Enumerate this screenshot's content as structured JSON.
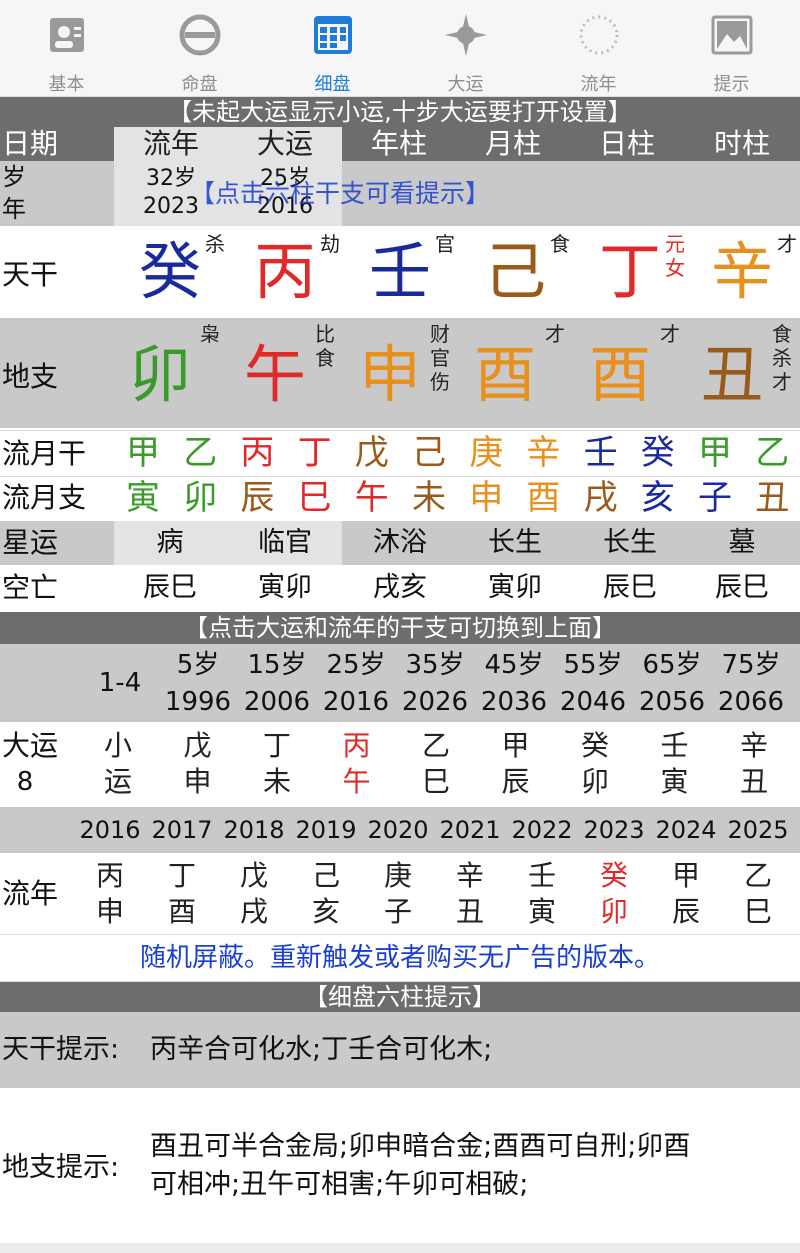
{
  "tabs": [
    {
      "label": "基本",
      "icon": "person-card-icon",
      "active": false
    },
    {
      "label": "命盘",
      "icon": "circle-minus-icon",
      "active": false
    },
    {
      "label": "细盘",
      "icon": "calendar-grid-icon",
      "active": true
    },
    {
      "label": "大运",
      "icon": "compass-icon",
      "active": false
    },
    {
      "label": "流年",
      "icon": "dotted-ring-icon",
      "active": false
    },
    {
      "label": "提示",
      "icon": "picture-icon",
      "active": false
    }
  ],
  "banner_top": "【未起大运显示小运,十步大运要打开设置】",
  "header": {
    "date": "日期",
    "liunian": "流年",
    "dayun": "大运",
    "nianzhu": "年柱",
    "yuezhu": "月柱",
    "rizhu": "日柱",
    "shizhu": "时柱"
  },
  "age_row": {
    "label_top": "岁",
    "label_bottom": "年",
    "ln_age": "32岁",
    "ln_year": "2023",
    "dy_age": "25岁",
    "dy_year": "2016",
    "hint": "【点击六柱干支可看提示】"
  },
  "tiangan": {
    "label": "天干",
    "cells": [
      {
        "char": "癸",
        "sup": "杀",
        "color": "#1a2a9e"
      },
      {
        "char": "丙",
        "sup": "劫",
        "color": "#e02a2a"
      },
      {
        "char": "壬",
        "sup": "官",
        "color": "#1a2a9e"
      },
      {
        "char": "己",
        "sup": "食",
        "color": "#9a5a1a"
      },
      {
        "char": "丁",
        "sup": "元\n女",
        "color": "#e02a2a",
        "sup_color": "#e02a2a"
      },
      {
        "char": "辛",
        "sup": "才",
        "color": "#e8901e"
      }
    ]
  },
  "dizhi": {
    "label": "地支",
    "cells": [
      {
        "char": "卯",
        "sup": "枭",
        "color": "#3a9a2a"
      },
      {
        "char": "午",
        "sup": "比\n食",
        "color": "#e02a2a"
      },
      {
        "char": "申",
        "sup": "财\n官\n伤",
        "color": "#e8901e"
      },
      {
        "char": "酉",
        "sup": "才",
        "color": "#e8901e"
      },
      {
        "char": "酉",
        "sup": "才",
        "color": "#e8901e"
      },
      {
        "char": "丑",
        "sup": "食\n杀\n才",
        "color": "#9a5a1a"
      }
    ]
  },
  "liuyue_gan": {
    "label": "流月干",
    "chars": [
      {
        "c": "甲",
        "color": "#3a9a2a"
      },
      {
        "c": "乙",
        "color": "#3a9a2a"
      },
      {
        "c": "丙",
        "color": "#e02a2a"
      },
      {
        "c": "丁",
        "color": "#e02a2a"
      },
      {
        "c": "戊",
        "color": "#9a5a1a"
      },
      {
        "c": "己",
        "color": "#9a5a1a"
      },
      {
        "c": "庚",
        "color": "#e8901e"
      },
      {
        "c": "辛",
        "color": "#e8901e"
      },
      {
        "c": "壬",
        "color": "#1a2a9e"
      },
      {
        "c": "癸",
        "color": "#1a2a9e"
      },
      {
        "c": "甲",
        "color": "#3a9a2a"
      },
      {
        "c": "乙",
        "color": "#3a9a2a"
      }
    ]
  },
  "liuyue_zhi": {
    "label": "流月支",
    "chars": [
      {
        "c": "寅",
        "color": "#3a9a2a"
      },
      {
        "c": "卯",
        "color": "#3a9a2a"
      },
      {
        "c": "辰",
        "color": "#9a5a1a"
      },
      {
        "c": "巳",
        "color": "#e02a2a"
      },
      {
        "c": "午",
        "color": "#e02a2a"
      },
      {
        "c": "未",
        "color": "#9a5a1a"
      },
      {
        "c": "申",
        "color": "#e8901e"
      },
      {
        "c": "酉",
        "color": "#e8901e"
      },
      {
        "c": "戌",
        "color": "#9a5a1a"
      },
      {
        "c": "亥",
        "color": "#1a2a9e"
      },
      {
        "c": "子",
        "color": "#1a2a9e"
      },
      {
        "c": "丑",
        "color": "#9a5a1a"
      }
    ]
  },
  "xingyun": {
    "label": "星运",
    "values": [
      "病",
      "临官",
      "沐浴",
      "长生",
      "长生",
      "墓"
    ]
  },
  "kongwang": {
    "label": "空亡",
    "values": [
      "辰巳",
      "寅卯",
      "戌亥",
      "寅卯",
      "辰巳",
      "辰巳"
    ]
  },
  "banner_mid": "【点击大运和流年的干支可切换到上面】",
  "dayun_ages": {
    "first": "1-4",
    "ages": [
      "5岁",
      "15岁",
      "25岁",
      "35岁",
      "45岁",
      "55岁",
      "65岁",
      "75岁"
    ],
    "years": [
      "1996",
      "2006",
      "2016",
      "2026",
      "2036",
      "2046",
      "2056",
      "2066"
    ]
  },
  "dayun_row": {
    "label_top": "大运",
    "label_bottom": "8",
    "items": [
      {
        "t": "小",
        "b": "运",
        "red": false
      },
      {
        "t": "戊",
        "b": "申",
        "red": false
      },
      {
        "t": "丁",
        "b": "未",
        "red": false
      },
      {
        "t": "丙",
        "b": "午",
        "red": true
      },
      {
        "t": "乙",
        "b": "巳",
        "red": false
      },
      {
        "t": "甲",
        "b": "辰",
        "red": false
      },
      {
        "t": "癸",
        "b": "卯",
        "red": false
      },
      {
        "t": "壬",
        "b": "寅",
        "red": false
      },
      {
        "t": "辛",
        "b": "丑",
        "red": false
      }
    ]
  },
  "liunian_years": [
    "2016",
    "2017",
    "2018",
    "2019",
    "2020",
    "2021",
    "2022",
    "2023",
    "2024",
    "2025"
  ],
  "liunian_row": {
    "label": "流年",
    "items": [
      {
        "t": "丙",
        "b": "申",
        "red": false
      },
      {
        "t": "丁",
        "b": "酉",
        "red": false
      },
      {
        "t": "戊",
        "b": "戌",
        "red": false
      },
      {
        "t": "己",
        "b": "亥",
        "red": false
      },
      {
        "t": "庚",
        "b": "子",
        "red": false
      },
      {
        "t": "辛",
        "b": "丑",
        "red": false
      },
      {
        "t": "壬",
        "b": "寅",
        "red": false
      },
      {
        "t": "癸",
        "b": "卯",
        "red": true
      },
      {
        "t": "甲",
        "b": "辰",
        "red": false
      },
      {
        "t": "乙",
        "b": "巳",
        "red": false
      }
    ]
  },
  "ad_text": "随机屏蔽。重新触发或者购买无广告的版本。",
  "banner_bottom": "【细盘六柱提示】",
  "tg_hint": {
    "label": "天干提示:",
    "text": "丙辛合可化水;丁壬合可化木;"
  },
  "dz_hint": {
    "label": "地支提示:",
    "line1": "酉丑可半合金局;卯申暗合金;酉酉可自刑;卯酉",
    "line2": "可相冲;丑午可相害;午卯可相破;"
  },
  "colors": {
    "accent": "#1e7bd8",
    "banner": "#6d6d6d",
    "hint_blue": "#1a3fd0",
    "red": "#e02a2a"
  }
}
